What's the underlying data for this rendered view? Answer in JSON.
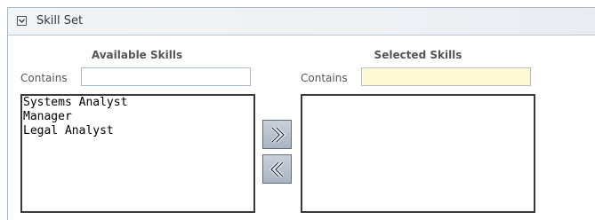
{
  "section": {
    "title": "Skill Set"
  },
  "available": {
    "heading": "Available Skills",
    "contains_label": "Contains",
    "contains_value": "",
    "items": [
      "Systems Analyst",
      "Manager",
      "Legal Analyst"
    ]
  },
  "selected": {
    "heading": "Selected Skills",
    "contains_label": "Contains",
    "contains_value": "",
    "items": []
  },
  "buttons": {
    "add_icon": "double-chevron-right-icon",
    "remove_icon": "double-chevron-left-icon"
  },
  "colors": {
    "selected_filter_bg": "#fefad4",
    "button_bg": "#b8c2ce"
  }
}
